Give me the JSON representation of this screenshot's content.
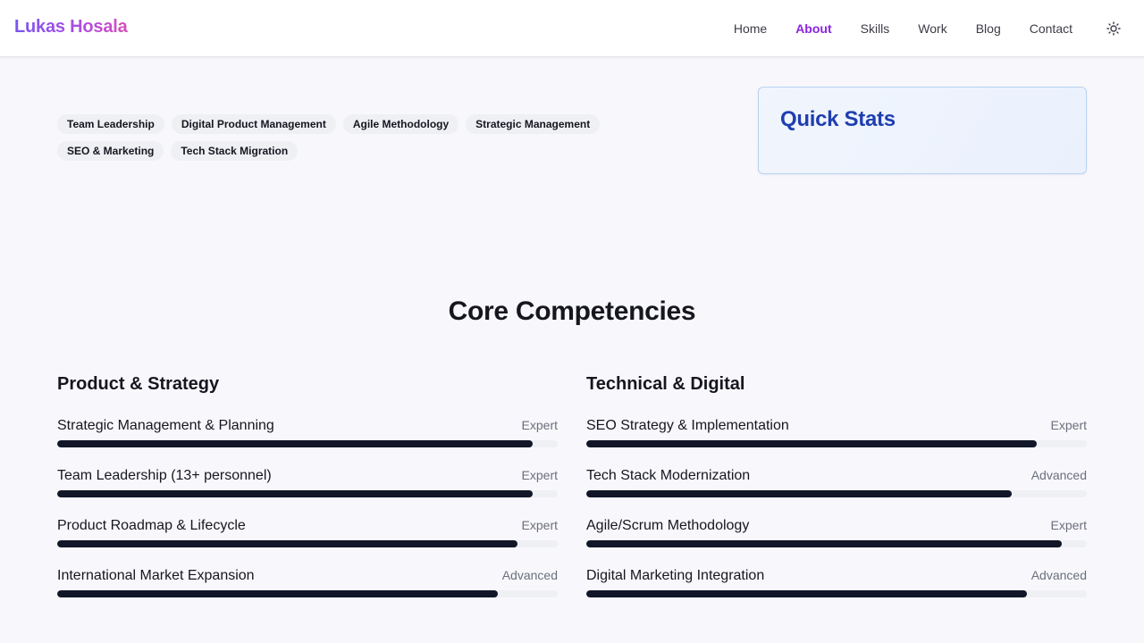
{
  "brand": "Lukas Hosala",
  "nav": {
    "items": [
      {
        "label": "Home",
        "active": false
      },
      {
        "label": "About",
        "active": true
      },
      {
        "label": "Skills",
        "active": false
      },
      {
        "label": "Work",
        "active": false
      },
      {
        "label": "Blog",
        "active": false
      },
      {
        "label": "Contact",
        "active": false
      }
    ],
    "theme_toggle_icon": "sun-icon"
  },
  "tags": [
    "Team Leadership",
    "Digital Product Management",
    "Agile Methodology",
    "Strategic Management",
    "SEO & Marketing",
    "Tech Stack Migration"
  ],
  "quick_stats": {
    "title": "Quick Stats"
  },
  "core": {
    "title": "Core Competencies",
    "columns": [
      {
        "title": "Product & Strategy",
        "skills": [
          {
            "name": "Strategic Management & Planning",
            "level": "Expert",
            "percent": 95
          },
          {
            "name": "Team Leadership (13+ personnel)",
            "level": "Expert",
            "percent": 95
          },
          {
            "name": "Product Roadmap & Lifecycle",
            "level": "Expert",
            "percent": 92
          },
          {
            "name": "International Market Expansion",
            "level": "Advanced",
            "percent": 88
          }
        ]
      },
      {
        "title": "Technical & Digital",
        "skills": [
          {
            "name": "SEO Strategy & Implementation",
            "level": "Expert",
            "percent": 90
          },
          {
            "name": "Tech Stack Modernization",
            "level": "Advanced",
            "percent": 85
          },
          {
            "name": "Agile/Scrum Methodology",
            "level": "Expert",
            "percent": 95
          },
          {
            "name": "Digital Marketing Integration",
            "level": "Advanced",
            "percent": 88
          }
        ]
      }
    ]
  },
  "colors": {
    "accent": "#8b23e0",
    "stats_title": "#1f3eb0",
    "bar_fill": "#111728",
    "bar_track": "#eef0f4"
  }
}
